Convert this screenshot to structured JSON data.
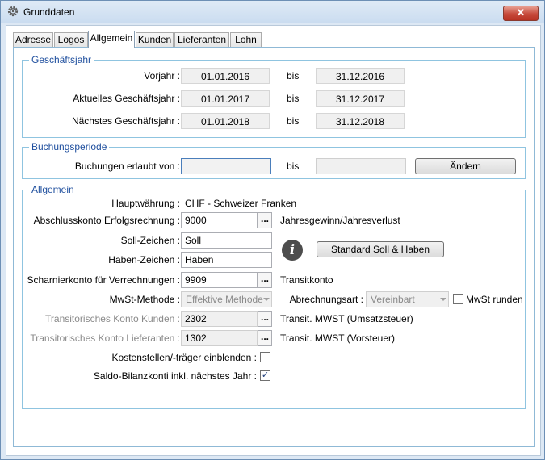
{
  "window": {
    "title": "Grunddaten",
    "close_label": "✕"
  },
  "tabs": [
    {
      "label": "Adresse"
    },
    {
      "label": "Logos"
    },
    {
      "label": "Allgemein"
    },
    {
      "label": "Kunden"
    },
    {
      "label": "Lieferanten"
    },
    {
      "label": "Lohn"
    }
  ],
  "geschaeftsjahr": {
    "title": "Geschäftsjahr",
    "rows": [
      {
        "label": "Vorjahr :",
        "from": "01.01.2016",
        "bis": "bis",
        "to": "31.12.2016"
      },
      {
        "label": "Aktuelles Geschäftsjahr :",
        "from": "01.01.2017",
        "bis": "bis",
        "to": "31.12.2017"
      },
      {
        "label": "Nächstes Geschäftsjahr :",
        "from": "01.01.2018",
        "bis": "bis",
        "to": "31.12.2018"
      }
    ]
  },
  "buchungsperiode": {
    "title": "Buchungsperiode",
    "label": "Buchungen erlaubt von :",
    "from": "",
    "bis": "bis",
    "to": "",
    "change_button": "Ändern"
  },
  "allgemein": {
    "title": "Allgemein",
    "hauptwaehrung_label": "Hauptwährung :",
    "hauptwaehrung_value": "CHF - Schweizer Franken",
    "abschluss_label": "Abschlusskonto Erfolgsrechnung :",
    "abschluss_value": "9000",
    "abschluss_desc": "Jahresgewinn/Jahresverlust",
    "soll_label": "Soll-Zeichen :",
    "soll_value": "Soll",
    "haben_label": "Haben-Zeichen :",
    "haben_value": "Haben",
    "standard_button": "Standard Soll & Haben",
    "info_glyph": "i",
    "scharnier_label": "Scharnierkonto für Verrechnungen :",
    "scharnier_value": "9909",
    "scharnier_desc": "Transitkonto",
    "mwst_methode_label": "MwSt-Methode :",
    "mwst_methode_value": "Effektive Methode",
    "abrechnungsart_label": "Abrechnungsart :",
    "abrechnungsart_value": "Vereinbart",
    "mwst_runden_label": "MwSt runden",
    "trans_kunden_label": "Transitorisches Konto Kunden :",
    "trans_kunden_value": "2302",
    "trans_kunden_desc": "Transit. MWST (Umsatzsteuer)",
    "trans_lief_label": "Transitorisches Konto Lieferanten :",
    "trans_lief_value": "1302",
    "trans_lief_desc": "Transit. MWST (Vorsteuer)",
    "kostenstellen_label": "Kostenstellen/-träger einblenden :",
    "saldo_label": "Saldo-Bilanzkonti inkl. nächstes Jahr :",
    "dots_glyph": "...",
    "check_glyph": "✓"
  }
}
